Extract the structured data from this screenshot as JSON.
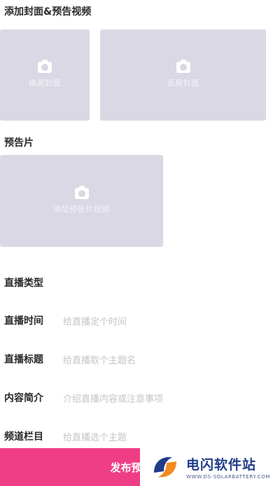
{
  "cover_section": {
    "title": "添加封面&预告视频",
    "cover_upload_label": "横屏封面",
    "video_upload_label": "竖屏封面"
  },
  "trailer_section": {
    "title": "预告片",
    "upload_label": "添加预告片视频"
  },
  "form": {
    "type": {
      "label": "直播类型",
      "value": ""
    },
    "time": {
      "label": "直播时间",
      "placeholder": "给直播定个时间"
    },
    "title": {
      "label": "直播标题",
      "placeholder": "给直播取个主题名"
    },
    "intro": {
      "label": "内容简介",
      "placeholder": "介绍直播内容或注意事项"
    },
    "channel": {
      "label": "频道栏目",
      "placeholder": "给直播选个主题"
    }
  },
  "submit": {
    "label": "发布预"
  },
  "watermark": {
    "title": "电闪软件站",
    "url": "WWW.DS-SOLARBATTERY.COM"
  },
  "colors": {
    "accent": "#ef3e85",
    "placeholder_bg": "#d9d8e4",
    "brand_blue": "#1f3b8a"
  }
}
